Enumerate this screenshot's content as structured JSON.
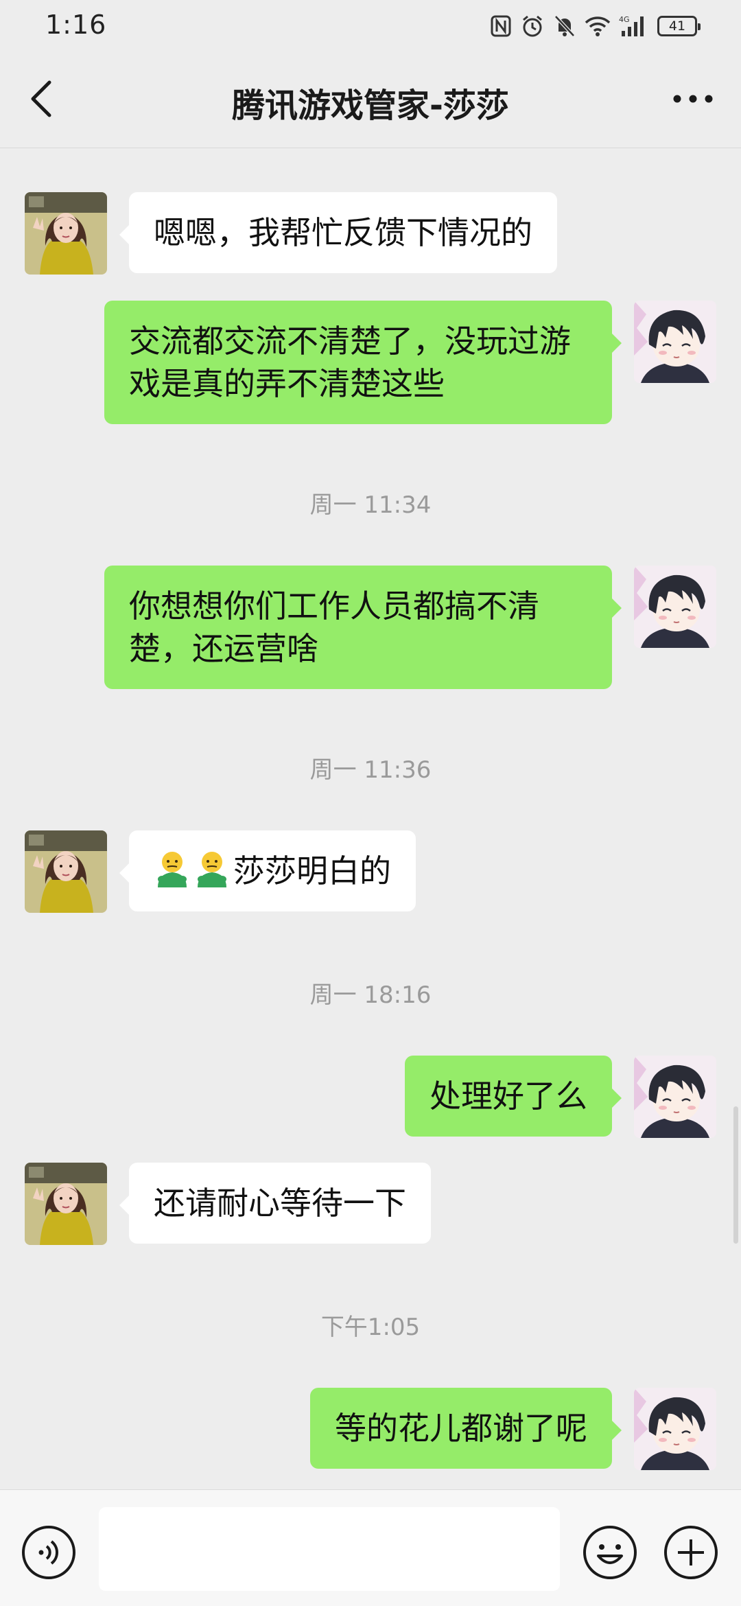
{
  "status_bar": {
    "time": "1:16",
    "network": "4G",
    "battery": "41"
  },
  "header": {
    "title": "腾讯游戏管家-莎莎"
  },
  "messages": [
    {
      "side": "left",
      "text": "嗯嗯，我帮忙反馈下情况的"
    },
    {
      "side": "right",
      "text": "交流都交流不清楚了，没玩过游戏是真的弄不清楚这些"
    },
    {
      "side": "time",
      "text": "周一 11:34"
    },
    {
      "side": "right",
      "text": "你想想你们工作人员都搞不清楚，还运营啥"
    },
    {
      "side": "time",
      "text": "周一 11:36"
    },
    {
      "side": "left",
      "text": "莎莎明白的",
      "emoji": [
        "emoji-figure",
        "emoji-figure"
      ]
    },
    {
      "side": "time",
      "text": "周一 18:16"
    },
    {
      "side": "right",
      "text": "处理好了么"
    },
    {
      "side": "left",
      "text": "还请耐心等待一下"
    },
    {
      "side": "time",
      "text": "下午1:05"
    },
    {
      "side": "right",
      "text": "等的花儿都谢了呢"
    }
  ],
  "input_bar": {
    "placeholder": ""
  },
  "colors": {
    "background": "#ededed",
    "bubble_self": "#95ec69",
    "bubble_other": "#ffffff",
    "timestamp": "#9a9a9a"
  }
}
